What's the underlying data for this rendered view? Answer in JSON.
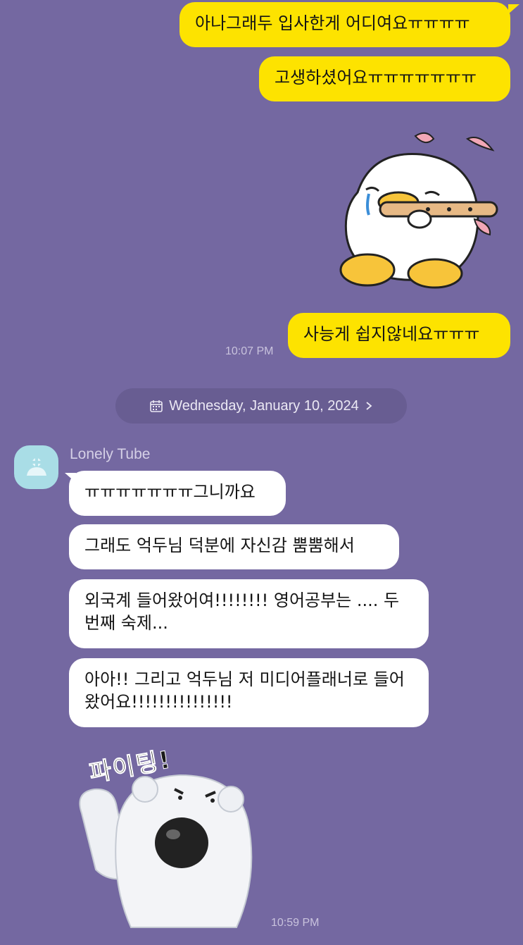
{
  "outgoing": [
    {
      "text": "아나그래두 입사한게 어디여요ㅠㅠㅠㅠ"
    },
    {
      "text": "고생하셨어요ㅠㅠㅠㅠㅠㅠㅠ"
    },
    {
      "text": "사능게 쉽지않네요ㅠㅠㅠ"
    }
  ],
  "outgoing_time": "10:07 PM",
  "date_separator": "Wednesday, January 10, 2024",
  "sender_name": "Lonely Tube",
  "incoming": [
    {
      "text": "ㅠㅠㅠㅠㅠㅠㅠ그니까요"
    },
    {
      "text": "그래도 억두님 덕분에 자신감 뿜뿜해서"
    },
    {
      "text": "외국계 들어왔어여!!!!!!!! 영어공부는 .... 두번째 숙제..."
    },
    {
      "text": "아아!! 그리고 억두님 저 미디어플래너로 들어왔어요!!!!!!!!!!!!!!!"
    }
  ],
  "sticker_text": "파이팅!",
  "incoming_time": "10:59 PM",
  "colors": {
    "background": "#7468a1",
    "my_bubble": "#fde300",
    "their_bubble": "#ffffff"
  }
}
